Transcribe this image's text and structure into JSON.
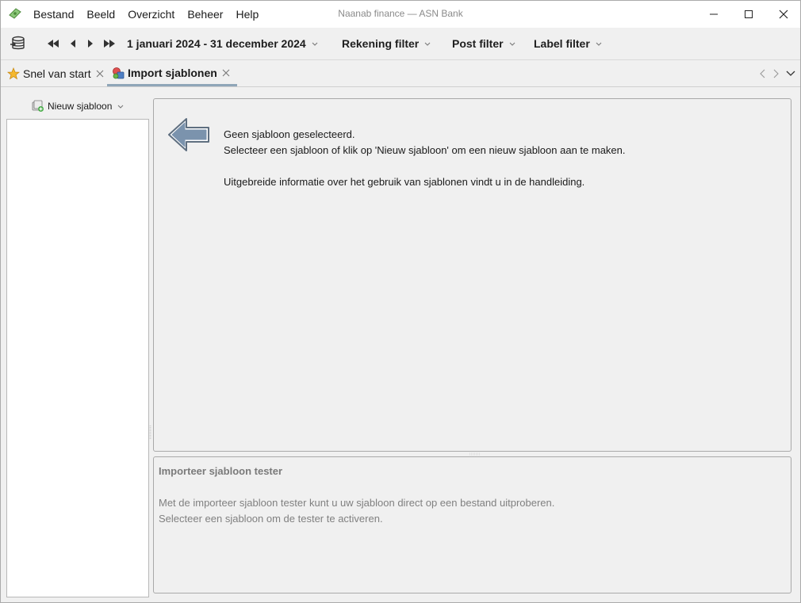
{
  "window": {
    "title": "Naanab finance — ASN Bank",
    "app_icon": "money-bill-icon"
  },
  "menu": {
    "items": [
      "Bestand",
      "Beeld",
      "Overzicht",
      "Beheer",
      "Help"
    ]
  },
  "toolbar": {
    "database_icon": "database-icon",
    "date_range": "1 januari 2024 - 31 december 2024",
    "account_filter": "Rekening filter",
    "post_filter": "Post filter",
    "label_filter": "Label filter"
  },
  "tabs": [
    {
      "label": "Snel van start",
      "icon": "star-icon",
      "active": false
    },
    {
      "label": "Import sjablonen",
      "icon": "import-templates-icon",
      "active": true
    }
  ],
  "left": {
    "new_template_label": "Nieuw sjabloon"
  },
  "info": {
    "line1": "Geen sjabloon geselecteerd.",
    "line2": "Selecteer een sjabloon of klik op 'Nieuw sjabloon' om een nieuw sjabloon aan te maken.",
    "line3": "Uitgebreide informatie over het gebruik van sjablonen vindt u in de handleiding."
  },
  "tester": {
    "title": "Importeer sjabloon tester",
    "line1": "Met de importeer sjabloon tester kunt u uw sjabloon direct op een bestand uitproberen.",
    "line2": "Selecteer een sjabloon om de tester te activeren."
  },
  "colors": {
    "tab_active_underline": "#8fa6b8",
    "arrow_fill": "#7b93ad",
    "disabled_text": "#808080"
  }
}
